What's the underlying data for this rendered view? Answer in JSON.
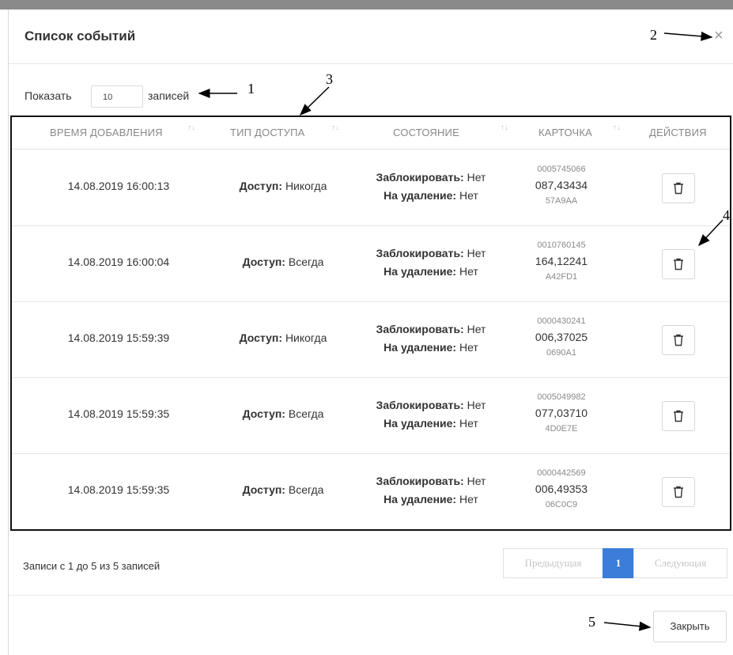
{
  "modal": {
    "title": "Список событий",
    "close_icon": "close-icon"
  },
  "length": {
    "show_label": "Показать",
    "value": "10",
    "entries_label": "записей"
  },
  "table": {
    "headers": [
      "ВРЕМЯ ДОБАВЛЕНИЯ",
      "ТИП ДОСТУПА",
      "СОСТОЯНИЕ",
      "КАРТОЧКА",
      "ДЕЙСТВИЯ"
    ],
    "sort_glyph": "↑↓",
    "label_access": "Доступ:",
    "label_block": "Заблокировать:",
    "label_delete": "На удаление:",
    "rows": [
      {
        "time": "14.08.2019 16:00:13",
        "access": "Никогда",
        "block": "Нет",
        "delete": "Нет",
        "card_top": "0005745066",
        "card_mid": "087,43434",
        "card_bot": "57A9AA"
      },
      {
        "time": "14.08.2019 16:00:04",
        "access": "Всегда",
        "block": "Нет",
        "delete": "Нет",
        "card_top": "0010760145",
        "card_mid": "164,12241",
        "card_bot": "A42FD1"
      },
      {
        "time": "14.08.2019 15:59:39",
        "access": "Никогда",
        "block": "Нет",
        "delete": "Нет",
        "card_top": "0000430241",
        "card_mid": "006,37025",
        "card_bot": "0690A1"
      },
      {
        "time": "14.08.2019 15:59:35",
        "access": "Всегда",
        "block": "Нет",
        "delete": "Нет",
        "card_top": "0005049982",
        "card_mid": "077,03710",
        "card_bot": "4D0E7E"
      },
      {
        "time": "14.08.2019 15:59:35",
        "access": "Всегда",
        "block": "Нет",
        "delete": "Нет",
        "card_top": "0000442569",
        "card_mid": "006,49353",
        "card_bot": "06C0C9"
      }
    ]
  },
  "footer": {
    "info": "Записи с 1 до 5 из 5 записей",
    "prev": "Предыдущая",
    "page": "1",
    "next": "Следующая",
    "close_button": "Закрыть"
  },
  "annotations": [
    "1",
    "2",
    "3",
    "4",
    "5"
  ],
  "colors": {
    "accent": "#3b7dd8",
    "border": "#111111"
  }
}
